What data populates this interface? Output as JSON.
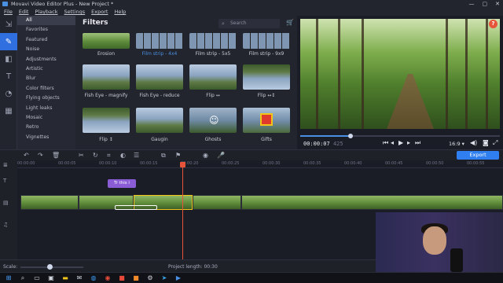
{
  "window": {
    "title": "Movavi Video Editor Plus - New Project *",
    "controls": [
      "—",
      "▢",
      "✕"
    ]
  },
  "menu": [
    "File",
    "Edit",
    "Playback",
    "Settings",
    "Export",
    "Help"
  ],
  "filters_panel": {
    "title": "Filters",
    "search_placeholder": "Search",
    "categories": [
      {
        "label": "All",
        "active": true
      },
      {
        "label": "Favorites"
      },
      {
        "label": "Featured"
      },
      {
        "label": "Noise"
      },
      {
        "label": "Adjustments"
      },
      {
        "label": "Artistic"
      },
      {
        "label": "Blur"
      },
      {
        "label": "Color filters"
      },
      {
        "label": "Flying objects"
      },
      {
        "label": "Light leaks"
      },
      {
        "label": "Mosaic"
      },
      {
        "label": "Retro"
      },
      {
        "label": "Vignettes"
      }
    ],
    "items": [
      {
        "label": "Erosion",
        "style": "t-forest"
      },
      {
        "label": "Film strip - 4x4",
        "style": "t-film",
        "selected": true
      },
      {
        "label": "Film strip - 5x5",
        "style": "t-film"
      },
      {
        "label": "Film strip - 9x9",
        "style": "t-film"
      },
      {
        "label": "Fish Eye - magnify",
        "style": "t-castle"
      },
      {
        "label": "Fish Eye - reduce",
        "style": "t-castle"
      },
      {
        "label": "Flip ↔",
        "style": "t-castle"
      },
      {
        "label": "Flip ↔↕",
        "style": "t-castle-inv"
      },
      {
        "label": "Flip ↕",
        "style": "t-castle-inv"
      },
      {
        "label": "Gaugin",
        "style": "t-castle"
      },
      {
        "label": "Ghosts",
        "style": "t-ghost"
      },
      {
        "label": "Gifts",
        "style": "t-gifts"
      }
    ]
  },
  "player": {
    "timecode_main": "00:00:07",
    "timecode_ms": "425",
    "aspect": "16:9 ▾",
    "progress": 0.25
  },
  "toolbar": {
    "export_label": "Export"
  },
  "ruler": [
    "00:00:00",
    "00:00:05",
    "00:00:10",
    "00:00:15",
    "00:00:20",
    "00:00:25",
    "00:00:30",
    "00:00:35",
    "00:00:40",
    "00:00:45",
    "00:00:50",
    "00:00:55",
    "00:01:00"
  ],
  "timeline": {
    "text_clip": "Tr this i"
  },
  "bottom": {
    "scale_label": "Scale:",
    "project_length": "Project length:  00:30"
  }
}
